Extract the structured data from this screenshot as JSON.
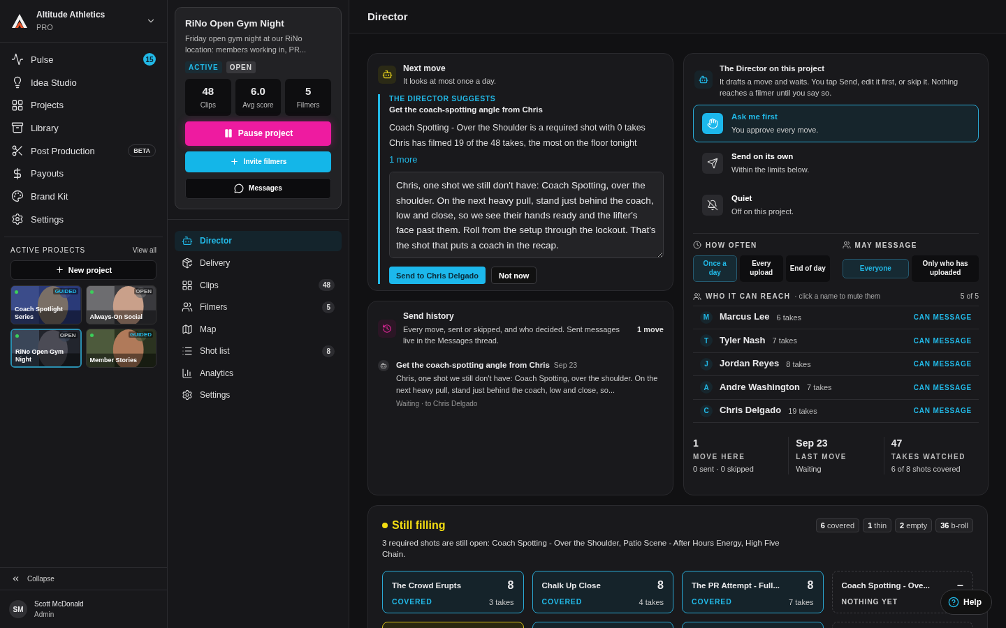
{
  "workspace": {
    "name": "Altitude Athletics",
    "plan": "PRO"
  },
  "nav": [
    {
      "label": "Pulse",
      "count": "15"
    },
    {
      "label": "Idea Studio"
    },
    {
      "label": "Projects"
    },
    {
      "label": "Library"
    },
    {
      "label": "Post Production",
      "tag": "BETA"
    },
    {
      "label": "Payouts"
    },
    {
      "label": "Brand Kit"
    },
    {
      "label": "Settings"
    }
  ],
  "active_projects": {
    "title": "ACTIVE PROJECTS",
    "view_all": "View all",
    "new_button": "New project",
    "items": [
      {
        "title": "Coach Spotlight Series",
        "tag": "GUIDED",
        "kind": "guided",
        "selected": false
      },
      {
        "title": "Always-On Social",
        "tag": "OPEN",
        "kind": "open",
        "selected": false
      },
      {
        "title": "RiNo Open Gym Night",
        "tag": "OPEN",
        "kind": "open",
        "selected": true
      },
      {
        "title": "Member Stories",
        "tag": "GUIDED",
        "kind": "guided",
        "selected": false
      }
    ]
  },
  "collapse": "Collapse",
  "user": {
    "initials": "SM",
    "name": "Scott McDonald",
    "role": "Admin"
  },
  "project": {
    "title": "RiNo Open Gym Night",
    "description": "Friday open gym night at our RiNo location: members working in, PR...",
    "badges": [
      {
        "label": "ACTIVE",
        "kind": "active"
      },
      {
        "label": "OPEN",
        "kind": "open"
      }
    ],
    "stats": [
      {
        "value": "48",
        "label": "Clips"
      },
      {
        "value": "6.0",
        "label": "Avg score"
      },
      {
        "value": "5",
        "label": "Filmers"
      }
    ],
    "buttons": [
      {
        "label": "Pause project",
        "kind": "pause"
      },
      {
        "label": "Invite filmers",
        "kind": "invite"
      },
      {
        "label": "Messages",
        "kind": "messages"
      }
    ]
  },
  "project_nav": [
    {
      "label": "Director",
      "selected": true
    },
    {
      "label": "Delivery",
      "selected": false
    },
    {
      "label": "Clips",
      "count": "48",
      "selected": false
    },
    {
      "label": "Filmers",
      "count": "5",
      "selected": false
    },
    {
      "label": "Map",
      "selected": false
    },
    {
      "label": "Shot list",
      "count": "8",
      "selected": false
    },
    {
      "label": "Analytics",
      "selected": false
    },
    {
      "label": "Settings",
      "selected": false
    }
  ],
  "page_title": "Director",
  "next_move": {
    "title": "Next move",
    "subtitle": "It looks at most once a day.",
    "eyebrow": "THE DIRECTOR SUGGESTS",
    "headline": "Get the coach-spotting angle from Chris",
    "reasons": [
      "Coach Spotting - Over the Shoulder is a required shot with 0 takes",
      "Chris has filmed 19 of the 48 takes, the most on the floor tonight"
    ],
    "more": "1 more",
    "draft": "Chris, one shot we still don't have: Coach Spotting, over the shoulder. On the next heavy pull, stand just behind the coach, low and close, so we see their hands ready and the lifter's face past them. Roll from the setup through the lockout. That's the shot that puts a coach in the recap.",
    "send_button": "Send to Chris Delgado",
    "skip_button": "Not now"
  },
  "history": {
    "title": "Send history",
    "subtitle": "Every move, sent or skipped, and who decided. Sent messages live in the Messages thread.",
    "count": "1 move",
    "entries": [
      {
        "title": "Get the coach-spotting angle from Chris",
        "date": "Sep 23",
        "body": "Chris, one shot we still don't have: Coach Spotting, over the shoulder. On the next heavy pull, stand just behind the coach, low and close, so...",
        "status": "Waiting · to Chris Delgado"
      }
    ]
  },
  "director": {
    "title": "The Director on this project",
    "subtitle": "It drafts a move and waits. You tap Send, edit it first, or skip it. Nothing reaches a filmer until you say so.",
    "modes": [
      {
        "title": "Ask me first",
        "subtitle": "You approve every move.",
        "selected": true
      },
      {
        "title": "Send on its own",
        "subtitle": "Within the limits below.",
        "selected": false
      },
      {
        "title": "Quiet",
        "subtitle": "Off on this project.",
        "selected": false
      }
    ],
    "how_often": {
      "title": "HOW OFTEN",
      "options": [
        {
          "label": "Once a day",
          "selected": true
        },
        {
          "label": "Every upload",
          "selected": false
        },
        {
          "label": "End of day",
          "selected": false
        }
      ]
    },
    "may_message": {
      "title": "MAY MESSAGE",
      "options": [
        {
          "label": "Everyone",
          "selected": true
        },
        {
          "label": "Only who has uploaded",
          "selected": false
        }
      ]
    },
    "reach": {
      "title": "WHO IT CAN REACH",
      "hint": "· click a name to mute them",
      "count": "5 of 5",
      "filmers": [
        {
          "initial": "M",
          "name": "Marcus Lee",
          "takes": "6 takes",
          "status": "CAN MESSAGE"
        },
        {
          "initial": "T",
          "name": "Tyler Nash",
          "takes": "7 takes",
          "status": "CAN MESSAGE"
        },
        {
          "initial": "J",
          "name": "Jordan Reyes",
          "takes": "8 takes",
          "status": "CAN MESSAGE"
        },
        {
          "initial": "A",
          "name": "Andre Washington",
          "takes": "7 takes",
          "status": "CAN MESSAGE"
        },
        {
          "initial": "C",
          "name": "Chris Delgado",
          "takes": "19 takes",
          "status": "CAN MESSAGE"
        }
      ]
    },
    "stats": [
      {
        "value": "1",
        "label": "MOVE HERE",
        "detail": "0 sent · 0 skipped"
      },
      {
        "value": "Sep 23",
        "label": "LAST MOVE",
        "detail": "Waiting"
      },
      {
        "value": "47",
        "label": "TAKES WATCHED",
        "detail": "6 of 8 shots covered"
      }
    ]
  },
  "coverage": {
    "title": "Still filling",
    "summary": "3 required shots are still open: Coach Spotting - Over the Shoulder, Patio Scene - After Hours Energy, High Five Chain.",
    "chips": [
      "**6** covered",
      "**1** thin",
      "**2** empty",
      "**36** b-roll"
    ],
    "shots": [
      {
        "title": "The Crowd Erupts",
        "count": "8",
        "status": "COVERED",
        "takes": "3 takes",
        "kind": "covered"
      },
      {
        "title": "Chalk Up Close",
        "count": "8",
        "status": "COVERED",
        "takes": "4 takes",
        "kind": "covered"
      },
      {
        "title": "The PR Attempt - Full...",
        "count": "8",
        "status": "COVERED",
        "takes": "7 takes",
        "kind": "covered"
      },
      {
        "title": "Coach Spotting - Ove...",
        "count": "–",
        "status": "NOTHING YET",
        "kind": "empty"
      },
      {
        "kind": "thin"
      },
      {
        "kind": "covered"
      },
      {
        "kind": "covered"
      },
      {
        "kind": "empty"
      }
    ]
  },
  "help_button": "Help"
}
